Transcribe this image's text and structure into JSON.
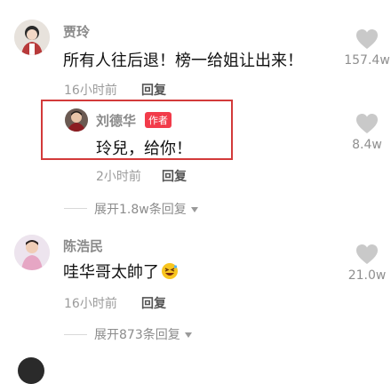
{
  "comments": [
    {
      "username": "贾玲",
      "text": "所有人往后退！榜一给姐让出来！",
      "time": "16小时前",
      "reply_label": "回复",
      "likes": "157.4w"
    },
    {
      "username": "刘德华",
      "badge": "作者",
      "text": "玲兒，给你！",
      "time": "2小时前",
      "reply_label": "回复",
      "likes": "8.4w"
    },
    {
      "expand_label": "展开1.8w条回复"
    },
    {
      "username": "陈浩民",
      "text": "哇华哥太帥了",
      "time": "16小时前",
      "reply_label": "回复",
      "likes": "21.0w"
    },
    {
      "expand_label": "展开873条回复"
    }
  ],
  "icons": {
    "like": "heart-icon",
    "expand": "triangle-down-icon",
    "emoji": "laughing-face-icon"
  },
  "colors": {
    "highlight_border": "#d33a3a",
    "author_badge": "#f23b4a",
    "heart": "#c9c9c9"
  }
}
